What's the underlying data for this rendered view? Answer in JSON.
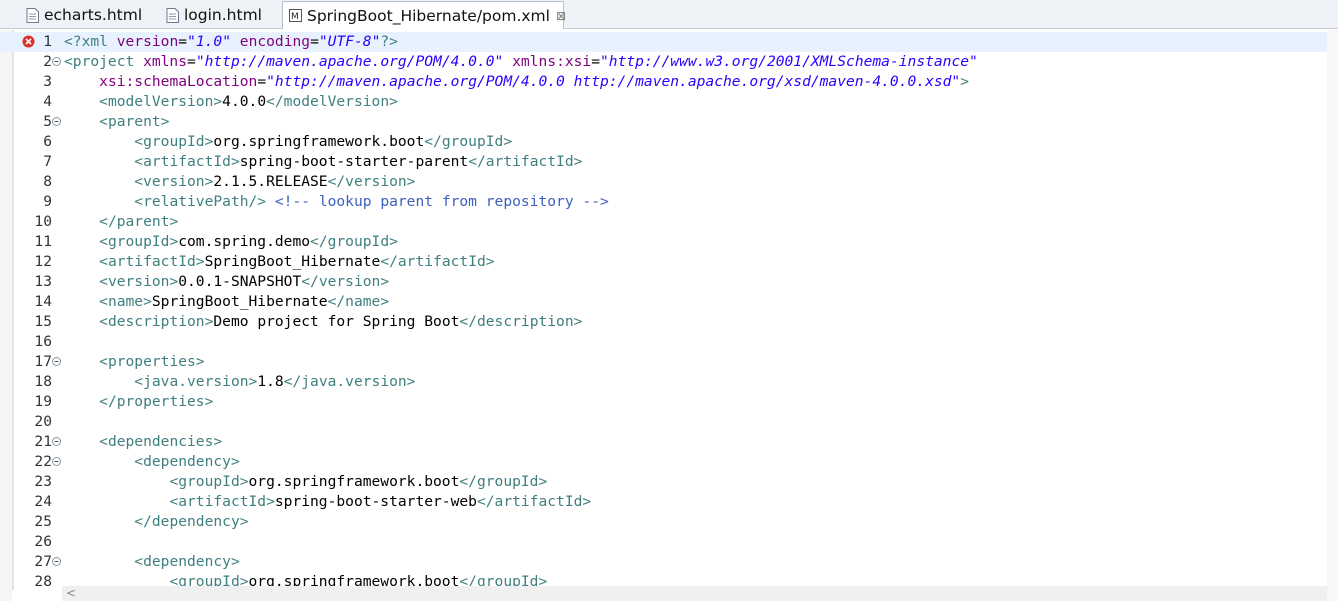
{
  "tabs": [
    {
      "label": "echarts.html",
      "active": false,
      "icon": "html-file-icon"
    },
    {
      "label": "login.html",
      "active": false,
      "icon": "html-file-icon"
    },
    {
      "label": "SpringBoot_Hibernate/pom.xml",
      "active": true,
      "icon": "maven-xml-file-icon",
      "close": "⊠"
    }
  ],
  "editor": {
    "error_line": 1,
    "current_line": 1,
    "lines": [
      {
        "n": "1",
        "fold": false,
        "segs": [
          [
            "pi",
            "<?"
          ],
          [
            "tag",
            "xml "
          ],
          [
            "attr",
            "version"
          ],
          [
            "txt",
            "="
          ],
          [
            "val",
            "\"1.0\""
          ],
          [
            "txt",
            " "
          ],
          [
            "attr",
            "encoding"
          ],
          [
            "txt",
            "="
          ],
          [
            "val",
            "\"UTF-8\""
          ],
          [
            "pi",
            "?>"
          ]
        ]
      },
      {
        "n": "2",
        "fold": true,
        "segs": [
          [
            "tag",
            "<project "
          ],
          [
            "attr",
            "xmlns"
          ],
          [
            "txt",
            "="
          ],
          [
            "val",
            "\"http://maven.apache.org/POM/4.0.0\""
          ],
          [
            "txt",
            " "
          ],
          [
            "attr",
            "xmlns:xsi"
          ],
          [
            "txt",
            "="
          ],
          [
            "val",
            "\"http://www.w3.org/2001/XMLSchema-instance\""
          ]
        ]
      },
      {
        "n": "3",
        "fold": false,
        "segs": [
          [
            "txt",
            "    "
          ],
          [
            "attr",
            "xsi:schemaLocation"
          ],
          [
            "txt",
            "="
          ],
          [
            "val",
            "\"http://maven.apache.org/POM/4.0.0 http://maven.apache.org/xsd/maven-4.0.0.xsd\""
          ],
          [
            "tag",
            ">"
          ]
        ]
      },
      {
        "n": "4",
        "fold": false,
        "segs": [
          [
            "txt",
            "    "
          ],
          [
            "tag",
            "<modelVersion>"
          ],
          [
            "txt",
            "4.0.0"
          ],
          [
            "tag",
            "</modelVersion>"
          ]
        ]
      },
      {
        "n": "5",
        "fold": true,
        "segs": [
          [
            "txt",
            "    "
          ],
          [
            "tag",
            "<parent>"
          ]
        ]
      },
      {
        "n": "6",
        "fold": false,
        "segs": [
          [
            "txt",
            "        "
          ],
          [
            "tag",
            "<groupId>"
          ],
          [
            "txt",
            "org.springframework.boot"
          ],
          [
            "tag",
            "</groupId>"
          ]
        ]
      },
      {
        "n": "7",
        "fold": false,
        "segs": [
          [
            "txt",
            "        "
          ],
          [
            "tag",
            "<artifactId>"
          ],
          [
            "txt",
            "spring-boot-starter-parent"
          ],
          [
            "tag",
            "</artifactId>"
          ]
        ]
      },
      {
        "n": "8",
        "fold": false,
        "segs": [
          [
            "txt",
            "        "
          ],
          [
            "tag",
            "<version>"
          ],
          [
            "txt",
            "2.1.5.RELEASE"
          ],
          [
            "tag",
            "</version>"
          ]
        ]
      },
      {
        "n": "9",
        "fold": false,
        "segs": [
          [
            "txt",
            "        "
          ],
          [
            "tag",
            "<relativePath/>"
          ],
          [
            "txt",
            " "
          ],
          [
            "cmt",
            "<!-- lookup parent from repository -->"
          ]
        ]
      },
      {
        "n": "10",
        "fold": false,
        "segs": [
          [
            "txt",
            "    "
          ],
          [
            "tag",
            "</parent>"
          ]
        ]
      },
      {
        "n": "11",
        "fold": false,
        "segs": [
          [
            "txt",
            "    "
          ],
          [
            "tag",
            "<groupId>"
          ],
          [
            "txt",
            "com.spring.demo"
          ],
          [
            "tag",
            "</groupId>"
          ]
        ]
      },
      {
        "n": "12",
        "fold": false,
        "segs": [
          [
            "txt",
            "    "
          ],
          [
            "tag",
            "<artifactId>"
          ],
          [
            "txt",
            "SpringBoot_Hibernate"
          ],
          [
            "tag",
            "</artifactId>"
          ]
        ]
      },
      {
        "n": "13",
        "fold": false,
        "segs": [
          [
            "txt",
            "    "
          ],
          [
            "tag",
            "<version>"
          ],
          [
            "txt",
            "0.0.1-SNAPSHOT"
          ],
          [
            "tag",
            "</version>"
          ]
        ]
      },
      {
        "n": "14",
        "fold": false,
        "segs": [
          [
            "txt",
            "    "
          ],
          [
            "tag",
            "<name>"
          ],
          [
            "txt",
            "SpringBoot_Hibernate"
          ],
          [
            "tag",
            "</name>"
          ]
        ]
      },
      {
        "n": "15",
        "fold": false,
        "segs": [
          [
            "txt",
            "    "
          ],
          [
            "tag",
            "<description>"
          ],
          [
            "txt",
            "Demo project for Spring Boot"
          ],
          [
            "tag",
            "</description>"
          ]
        ]
      },
      {
        "n": "16",
        "fold": false,
        "segs": []
      },
      {
        "n": "17",
        "fold": true,
        "segs": [
          [
            "txt",
            "    "
          ],
          [
            "tag",
            "<properties>"
          ]
        ]
      },
      {
        "n": "18",
        "fold": false,
        "segs": [
          [
            "txt",
            "        "
          ],
          [
            "tag",
            "<java.version>"
          ],
          [
            "txt",
            "1.8"
          ],
          [
            "tag",
            "</java.version>"
          ]
        ]
      },
      {
        "n": "19",
        "fold": false,
        "segs": [
          [
            "txt",
            "    "
          ],
          [
            "tag",
            "</properties>"
          ]
        ]
      },
      {
        "n": "20",
        "fold": false,
        "segs": []
      },
      {
        "n": "21",
        "fold": true,
        "segs": [
          [
            "txt",
            "    "
          ],
          [
            "tag",
            "<dependencies>"
          ]
        ]
      },
      {
        "n": "22",
        "fold": true,
        "segs": [
          [
            "txt",
            "        "
          ],
          [
            "tag",
            "<dependency>"
          ]
        ]
      },
      {
        "n": "23",
        "fold": false,
        "segs": [
          [
            "txt",
            "            "
          ],
          [
            "tag",
            "<groupId>"
          ],
          [
            "txt",
            "org.springframework.boot"
          ],
          [
            "tag",
            "</groupId>"
          ]
        ]
      },
      {
        "n": "24",
        "fold": false,
        "segs": [
          [
            "txt",
            "            "
          ],
          [
            "tag",
            "<artifactId>"
          ],
          [
            "txt",
            "spring-boot-starter-web"
          ],
          [
            "tag",
            "</artifactId>"
          ]
        ]
      },
      {
        "n": "25",
        "fold": false,
        "segs": [
          [
            "txt",
            "        "
          ],
          [
            "tag",
            "</dependency>"
          ]
        ]
      },
      {
        "n": "26",
        "fold": false,
        "segs": []
      },
      {
        "n": "27",
        "fold": true,
        "segs": [
          [
            "txt",
            "        "
          ],
          [
            "tag",
            "<dependency>"
          ]
        ]
      },
      {
        "n": "28",
        "fold": false,
        "segs": [
          [
            "txt",
            "            "
          ],
          [
            "tag",
            "<groupId>"
          ],
          [
            "txt",
            "org.springframework.boot"
          ],
          [
            "tag",
            "</groupId>"
          ]
        ]
      }
    ]
  },
  "scrollbar": {
    "left_arrow": "<"
  }
}
